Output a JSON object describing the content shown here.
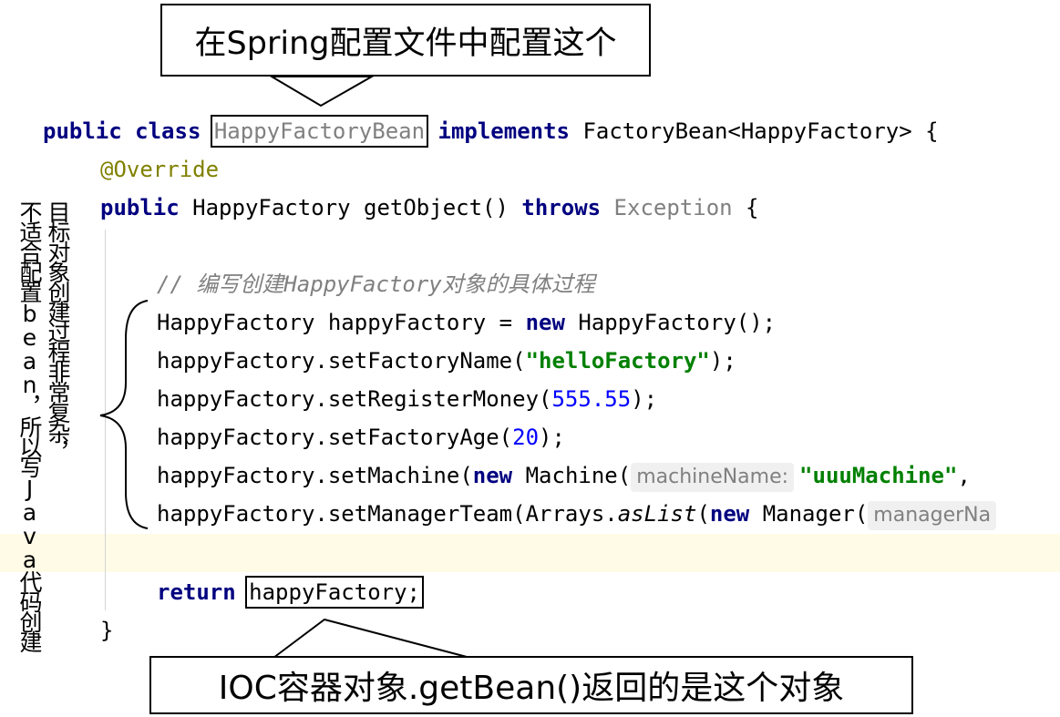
{
  "callouts": {
    "top": "在Spring配置文件中配置这个",
    "bottom": "IOC容器对象.getBean()返回的是这个对象"
  },
  "side_note": {
    "col1": "目标对象创建过程非常复杂，",
    "col2": "不适合配置bean，所以写Java代码创建"
  },
  "code": {
    "line1": {
      "kw_public": "public",
      "kw_class": "class",
      "class_name": "HappyFactoryBean",
      "kw_implements": "implements",
      "rest": "FactoryBean<HappyFactory> {"
    },
    "line2": {
      "annotation": "@Override"
    },
    "line3": {
      "kw_public": "public",
      "sig": "HappyFactory getObject()",
      "kw_throws": "throws",
      "exception": "Exception",
      "brace": "{"
    },
    "line4": {
      "comment": "// 编写创建HappyFactory对象的具体过程"
    },
    "line5": {
      "start": "HappyFactory happyFactory = ",
      "kw_new": "new",
      "end": " HappyFactory();"
    },
    "line6": {
      "start": "happyFactory.setFactoryName(",
      "str": "\"helloFactory\"",
      "end": ");"
    },
    "line7": {
      "start": "happyFactory.setRegisterMoney(",
      "num": "555.55",
      "end": ");"
    },
    "line8": {
      "start": "happyFactory.setFactoryAge(",
      "num": "20",
      "end": ");"
    },
    "line9": {
      "start": "happyFactory.setMachine(",
      "kw_new": "new",
      "mid": " Machine(",
      "hint": "machineName:",
      "str": "\"uuuMachine\"",
      "end": ","
    },
    "line10": {
      "start": "happyFactory.setManagerTeam(Arrays.",
      "method": "asList",
      "paren": "(",
      "kw_new": "new",
      "mid": " Manager(",
      "hint": "managerNa"
    },
    "line12": {
      "kw_return": "return",
      "value": "happyFactory;"
    },
    "line13": {
      "brace": "}"
    }
  }
}
